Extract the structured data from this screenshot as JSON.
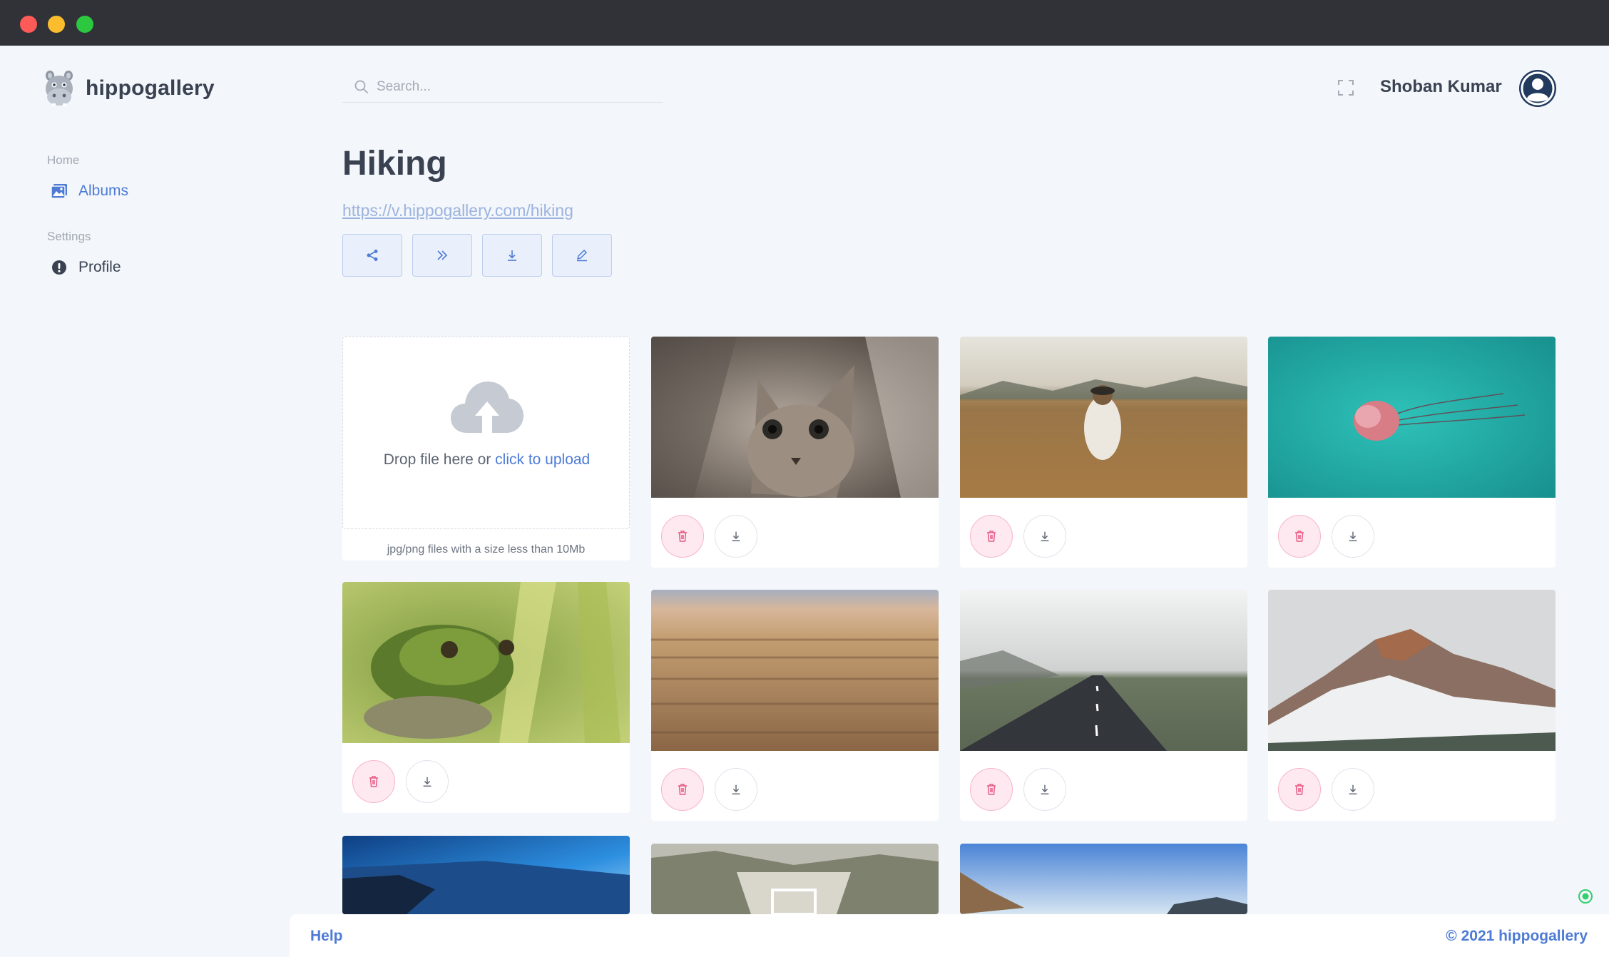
{
  "app": {
    "name": "hippogallery"
  },
  "colors": {
    "accent": "#4d7bd6",
    "danger": "#e85a86",
    "background": "#f3f6fa",
    "titlebar": "#303238"
  },
  "sidebar": {
    "sections": [
      {
        "label": "Home",
        "items": [
          {
            "label": "Albums",
            "icon": "image-icon",
            "active": true
          }
        ]
      },
      {
        "label": "Settings",
        "items": [
          {
            "label": "Profile",
            "icon": "alert-circle-icon",
            "active": false
          }
        ]
      }
    ]
  },
  "search": {
    "placeholder": "Search...",
    "value": ""
  },
  "user": {
    "name": "Shoban Kumar",
    "avatar_icon": "user-avatar-icon"
  },
  "album": {
    "title": "Hiking",
    "url": "https://v.hippogallery.com/hiking",
    "actions": [
      "share-icon",
      "double-chevron-right-icon",
      "download-icon",
      "edit-icon"
    ]
  },
  "upload": {
    "prompt": "Drop file here or ",
    "link": "click to upload",
    "hint": "jpg/png files with a size less than 10Mb",
    "icon": "cloud-upload-icon"
  },
  "photos": [
    {
      "subject": "kitten"
    },
    {
      "subject": "woman in wheat field"
    },
    {
      "subject": "jellyfish"
    },
    {
      "subject": "frog"
    },
    {
      "subject": "forest aerial"
    },
    {
      "subject": "road"
    },
    {
      "subject": "snowy mountain"
    },
    {
      "subject": "blue mountain sunrise"
    },
    {
      "subject": "rocky cliffs"
    },
    {
      "subject": "sky over hills"
    }
  ],
  "footer": {
    "help": "Help",
    "copyright": "© 2021 hippogallery"
  }
}
